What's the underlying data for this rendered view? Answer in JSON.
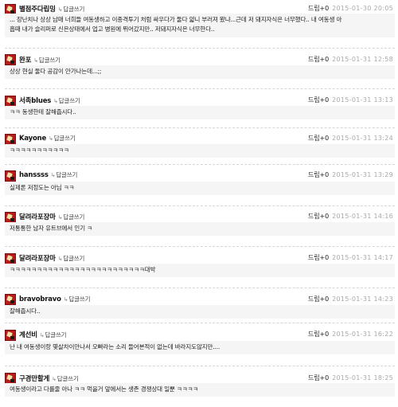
{
  "comments": [
    {
      "nickname": "별점주다립밍",
      "reply_label": "답글쓰기",
      "drip_label": "드립+",
      "drip_count": "0",
      "date": "2015-01-30 20:05",
      "lines": [
        "... 장난치나 상상 남매 너희들 여동생하고 이종격투기 처럼 싸우다가 둘다 얇니 부러져 봤냐...근데 저 돼지자식은 너무했다.. 내 여동생 아",
        "홉때 내가 슬리퍼로 신은상태에서 업고 병원에 뛰어갔지만.. 저돼지자식은 너무한다.."
      ]
    },
    {
      "nickname": "완포",
      "reply_label": "답글쓰기",
      "drip_label": "드립+",
      "drip_count": "0",
      "date": "2015-01-31 12:58",
      "lines": [
        "상상 현실 둘다 공감이 안가나는데...;;"
      ]
    },
    {
      "nickname": "서족blues",
      "reply_label": "답글쓰기",
      "drip_label": "드립+",
      "drip_count": "0",
      "date": "2015-01-31 13:13",
      "lines": [
        "ㅋㅋ 동생한테 잘해줍시다.."
      ]
    },
    {
      "nickname": "Kayone",
      "reply_label": "답글쓰기",
      "drip_label": "드립+",
      "drip_count": "0",
      "date": "2015-01-31 13:24",
      "lines": [
        "ㅋㅋㅋㅋㅋㅋㅋㅋㅋㅋㅋ"
      ]
    },
    {
      "nickname": "hanssss",
      "reply_label": "답글쓰기",
      "drip_label": "드립+",
      "drip_count": "0",
      "date": "2015-01-31 13:29",
      "lines": [
        "실제론 저정도는 아님 ㅋㅋ"
      ]
    },
    {
      "nickname": "달려라포장마",
      "reply_label": "답글쓰기",
      "drip_label": "드립+",
      "drip_count": "0",
      "date": "2015-01-31 14:16",
      "lines": [
        "저통통한 남자 유트브에서 인기 ㅋ"
      ]
    },
    {
      "nickname": "달려라포장마",
      "reply_label": "답글쓰기",
      "drip_label": "드립+",
      "drip_count": "0",
      "date": "2015-01-31 14:17",
      "lines": [
        "ㅋㅋㅋㅋㅋㅋㅋㅋㅋㅋㅋㅋㅋㅋㅋㅋㅋㅋㅋㅋㅋㅋㅋㅋㅋ대박"
      ]
    },
    {
      "nickname": "bravobravo",
      "reply_label": "답글쓰기",
      "drip_label": "드립+",
      "drip_count": "0",
      "date": "2015-01-31 14:23",
      "lines": [
        "잘해줍시다.."
      ]
    },
    {
      "nickname": "계선비",
      "reply_label": "답글쓰기",
      "drip_label": "드립+",
      "drip_count": "0",
      "date": "2015-01-31 16:22",
      "lines": [
        "난 내 여동생이랑 몇살차이안나서 오빠라는 소리 들어본적이 없는데 바라지도않지만...."
      ]
    },
    {
      "nickname": "구경만할게",
      "reply_label": "답글쓰기",
      "drip_label": "드립+",
      "drip_count": "0",
      "date": "2015-01-31 18:25",
      "lines": [
        "여동생이라고 다를줄 아나 ㅋㅋ 먹을거 앞에서는 생존 경쟁상대 일뿐 ㅋㅋㅋㅋ"
      ]
    }
  ]
}
